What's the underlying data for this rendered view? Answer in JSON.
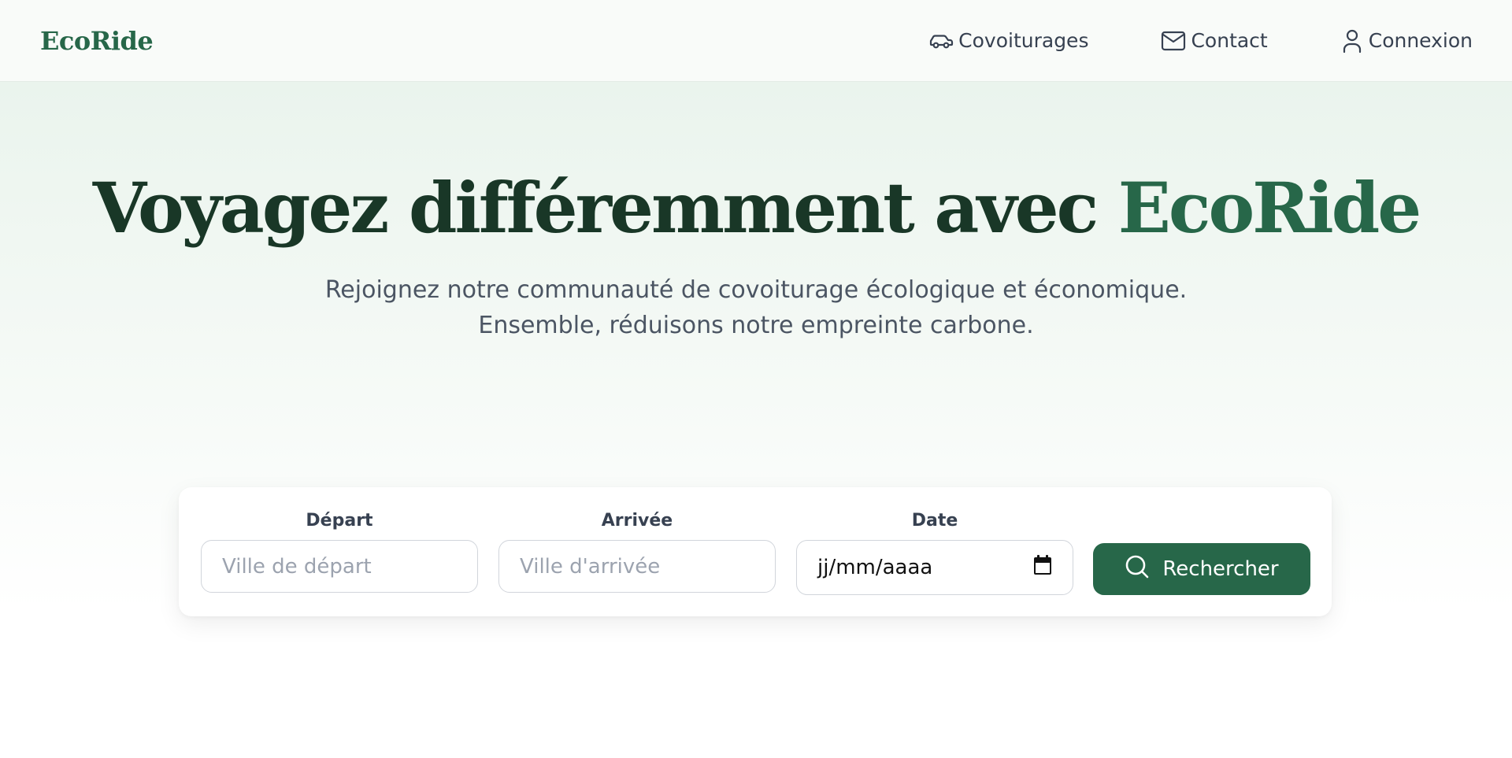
{
  "header": {
    "brand": "EcoRide",
    "nav": [
      {
        "label": "Covoiturages",
        "icon": "car-icon"
      },
      {
        "label": "Contact",
        "icon": "mail-icon"
      },
      {
        "label": "Connexion",
        "icon": "user-icon"
      }
    ]
  },
  "hero": {
    "title_main": "Voyagez différemment avec ",
    "title_accent": "EcoRide",
    "subtitle": "Rejoignez notre communauté de covoiturage écologique et économique. Ensemble, réduisons notre empreinte carbone."
  },
  "search": {
    "departure_label": "Départ",
    "departure_placeholder": "Ville de départ",
    "arrival_label": "Arrivée",
    "arrival_placeholder": "Ville d'arrivée",
    "date_label": "Date",
    "date_value": "jj/mm/aaaa",
    "button_label": "Rechercher",
    "button_icon": "search-icon"
  },
  "colors": {
    "brand": "#276749",
    "title": "#193727",
    "text": "#374151"
  }
}
